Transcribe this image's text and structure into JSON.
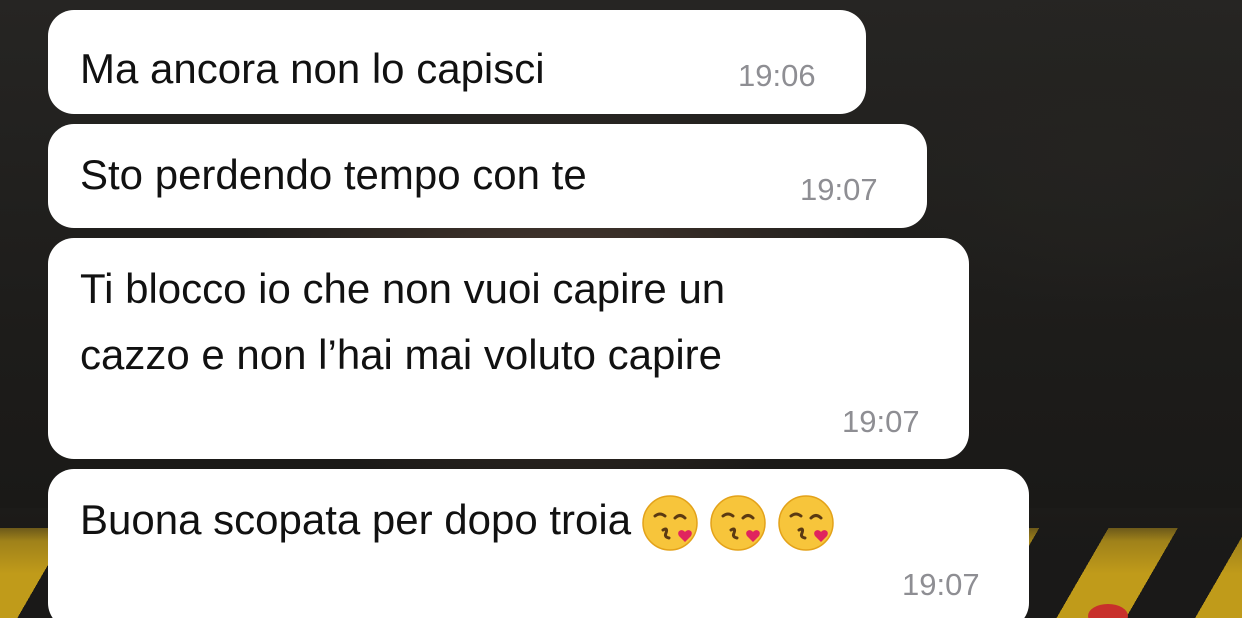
{
  "colors": {
    "bubble_background": "#ffffff",
    "message_text": "#111111",
    "timestamp_text": "#8e8e93",
    "wallpaper_accent": "#c9a21a"
  },
  "messages": [
    {
      "text": "Ma ancora non lo capisci",
      "time": "19:06"
    },
    {
      "text": "Sto perdendo tempo con te",
      "time": "19:07"
    },
    {
      "lines": [
        "Ti blocco io che non vuoi capire un",
        "cazzo e non l’hai mai voluto capire"
      ],
      "time": "19:07"
    },
    {
      "text": "Buona scopata per dopo troia",
      "emojis": [
        "face-blowing-kiss-icon",
        "face-blowing-kiss-icon",
        "face-blowing-kiss-icon"
      ],
      "time": "19:07"
    }
  ]
}
